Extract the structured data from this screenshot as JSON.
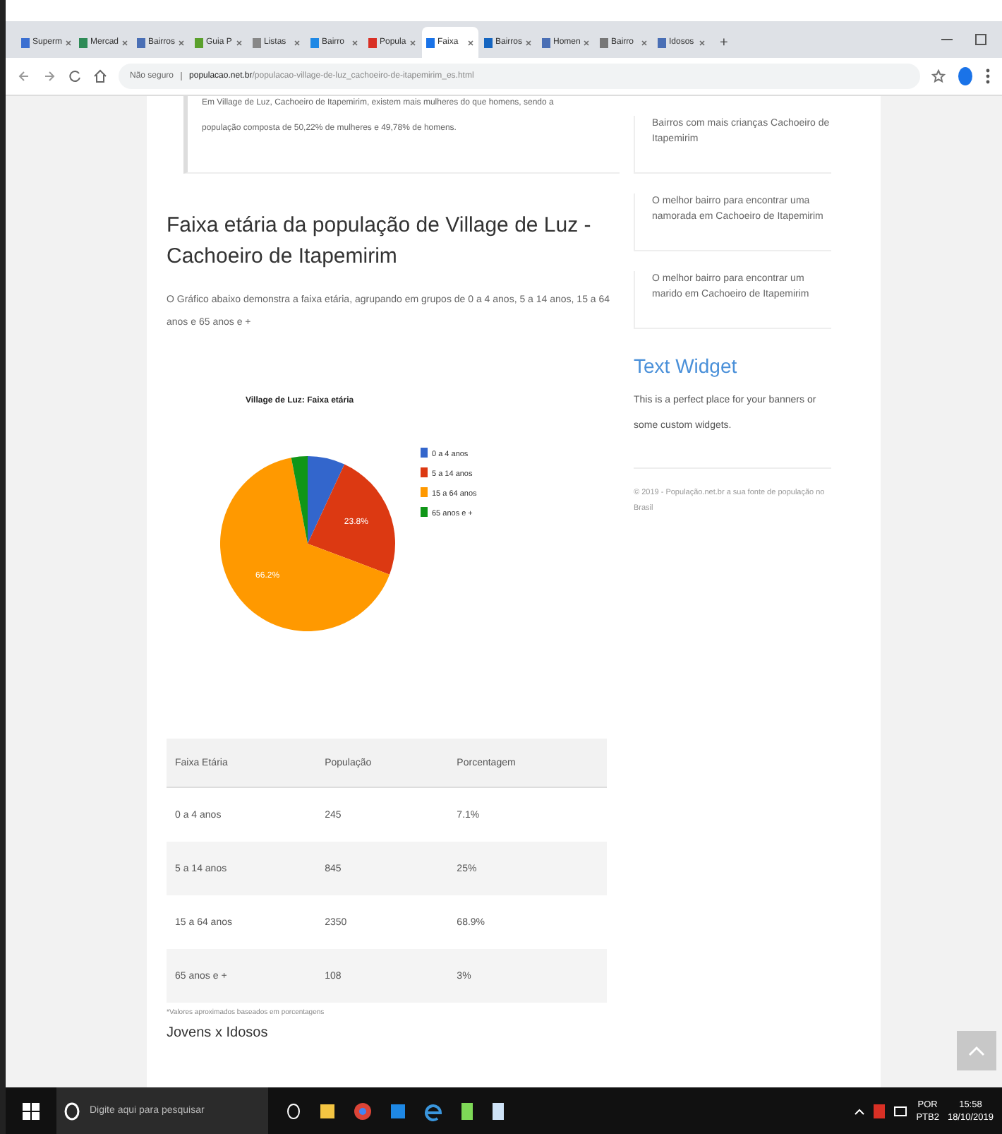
{
  "browser": {
    "tabs": [
      {
        "label": "Superm",
        "selected": false,
        "color": "#3b6fd1"
      },
      {
        "label": "Mercad",
        "selected": false,
        "color": "#2e8b57"
      },
      {
        "label": "Bairros",
        "selected": false,
        "color": "#4a6fb5"
      },
      {
        "label": "Guia P",
        "selected": false,
        "color": "#5aa02c"
      },
      {
        "label": "Listas",
        "selected": false,
        "color": "#888888"
      },
      {
        "label": "Bairro",
        "selected": false,
        "color": "#1e88e5"
      },
      {
        "label": "Popula",
        "selected": false,
        "color": "#d93025"
      },
      {
        "label": "Faixa",
        "selected": true,
        "color": "#1a73e8"
      },
      {
        "label": "Bairros",
        "selected": false,
        "color": "#1565c0"
      },
      {
        "label": "Homen",
        "selected": false,
        "color": "#4a6fb5"
      },
      {
        "label": "Bairro",
        "selected": false,
        "color": "#777777"
      },
      {
        "label": "Idosos",
        "selected": false,
        "color": "#4a6fb5"
      }
    ],
    "new_tab": "+",
    "security": "Não seguro",
    "url_domain": "populacao.net.br",
    "url_path": "/populacao-village-de-luz_cachoeiro-de-itapemirim_es.html"
  },
  "article": {
    "quote_lines": [
      "Em Village de Luz, Cachoeiro de Itapemirim, existem mais mulheres do que homens, sendo a",
      "população composta de 50,22% de mulheres e 49,78% de homens."
    ],
    "heading": "Faixa etária da população de Village de Luz - Cachoeiro de Itapemirim",
    "intro": "O Gráfico abaixo demonstra a faixa etária, agrupando em grupos de 0 a 4 anos, 5 a 14 anos, 15 a 64 anos e 65 anos e +",
    "chart_data": {
      "type": "pie",
      "title": "Village de Luz: Faixa etária",
      "categories": [
        "0 a 4 anos",
        "5 a 14 anos",
        "15 a 64 anos",
        "65 anos e +"
      ],
      "values": [
        6.9,
        23.8,
        66.2,
        3.0
      ],
      "colors": [
        "#3366cc",
        "#dc3912",
        "#ff9900",
        "#109618"
      ],
      "value_labels": [
        null,
        "23.8%",
        "66.2%",
        null
      ],
      "legend": "right"
    },
    "table": {
      "columns": [
        "Faixa Etária",
        "População",
        "Porcentagem"
      ],
      "rows": [
        [
          "0 a 4 anos",
          "245",
          "7.1%"
        ],
        [
          "5 a 14 anos",
          "845",
          "25%"
        ],
        [
          "15 a 64 anos",
          "2350",
          "68.9%"
        ],
        [
          "65 anos e +",
          "108",
          "3%"
        ]
      ]
    },
    "footnote": "*Valores aproximados baseados em porcentagens",
    "next_heading": "Jovens x Idosos"
  },
  "sidebar": {
    "links": [
      "Bairros com mais crianças Cachoeiro de Itapemirim",
      "O melhor bairro para encontrar uma namorada em Cachoeiro de Itapemirim",
      "O melhor bairro para encontrar um marido em Cachoeiro de Itapemirim"
    ],
    "widget_title": "Text Widget",
    "widget_text": "This is a perfect place for your banners or some custom widgets.",
    "copyright": "© 2019 - População.net.br a sua fonte de população no Brasil"
  },
  "taskbar": {
    "search_placeholder": "Digite aqui para pesquisar",
    "language": "POR",
    "layout": "PTB2",
    "time": "15:58",
    "date": "18/10/2019"
  }
}
